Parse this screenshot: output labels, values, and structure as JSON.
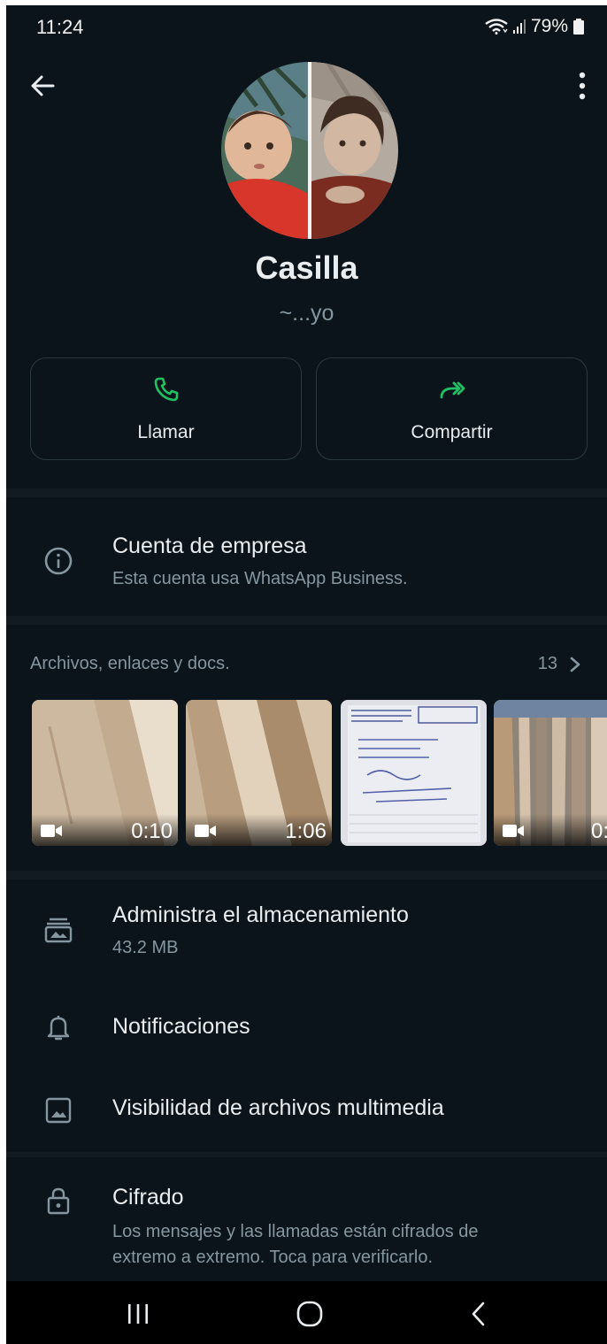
{
  "status_bar": {
    "time": "11:24",
    "battery": "79%"
  },
  "contact": {
    "name": "Casilla",
    "about": "~...yo"
  },
  "actions": {
    "call_label": "Llamar",
    "share_label": "Compartir"
  },
  "business": {
    "title": "Cuenta de empresa",
    "subtitle": "Esta cuenta usa WhatsApp Business."
  },
  "media": {
    "title": "Archivos, enlaces y docs.",
    "count": "13",
    "items": [
      {
        "type": "video",
        "duration": "0:10"
      },
      {
        "type": "video",
        "duration": "1:06"
      },
      {
        "type": "image",
        "duration": ""
      },
      {
        "type": "video",
        "duration": "0:"
      }
    ]
  },
  "storage": {
    "title": "Administra el almacenamiento",
    "size": "43.2 MB"
  },
  "notifications": {
    "title": "Notificaciones"
  },
  "media_visibility": {
    "title": "Visibilidad de archivos multimedia"
  },
  "encryption": {
    "title": "Cifrado",
    "line1": "Los mensajes y las llamadas están cifrados de",
    "line2": "extremo a extremo. Toca para verificarlo."
  },
  "colors": {
    "background": "#0b141a",
    "accent": "#21c063",
    "secondary_text": "#8696a0",
    "primary_text": "#e9edef"
  },
  "icons": {
    "back": "arrow-left-icon",
    "menu": "more-vertical-icon",
    "call": "phone-icon",
    "share": "share-arrow-icon",
    "info": "info-icon",
    "storage": "folder-stack-icon",
    "notifications": "bell-icon",
    "media_visibility": "image-icon",
    "encryption": "lock-icon"
  }
}
